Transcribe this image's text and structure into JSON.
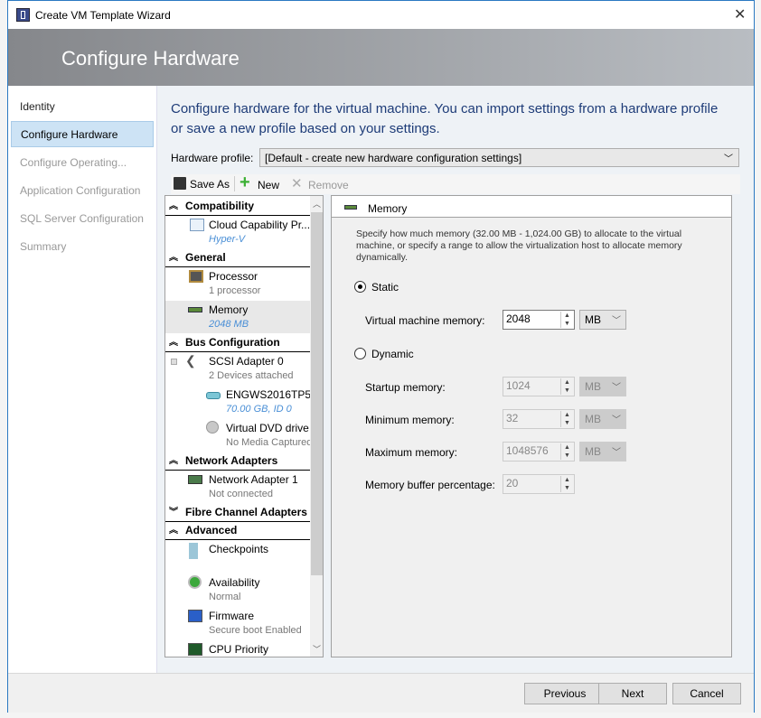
{
  "window": {
    "title": "Create VM Template Wizard"
  },
  "header": {
    "title": "Configure Hardware"
  },
  "nav": {
    "items": [
      {
        "label": "Identity",
        "state": "done"
      },
      {
        "label": "Configure Hardware",
        "state": "selected"
      },
      {
        "label": "Configure Operating...",
        "state": "pending"
      },
      {
        "label": "Application Configuration",
        "state": "pending"
      },
      {
        "label": "SQL Server Configuration",
        "state": "pending"
      },
      {
        "label": "Summary",
        "state": "pending"
      }
    ]
  },
  "main": {
    "intro": "Configure hardware for the virtual machine. You can import settings from a hardware profile or save a new profile based on your settings.",
    "profile_label": "Hardware profile:",
    "profile_value": "[Default - create new hardware configuration settings]",
    "toolbar": {
      "save_as": "Save As",
      "new": "New",
      "remove": "Remove"
    },
    "tree": {
      "groups": {
        "compatibility": "Compatibility",
        "general": "General",
        "bus": "Bus Configuration",
        "network": "Network Adapters",
        "fibre": "Fibre Channel Adapters",
        "advanced": "Advanced"
      },
      "items": {
        "cloud": {
          "title": "Cloud Capability Pr...",
          "sub": "Hyper-V"
        },
        "processor": {
          "title": "Processor",
          "sub": "1 processor"
        },
        "memory": {
          "title": "Memory",
          "sub": "2048 MB"
        },
        "scsi": {
          "title": "SCSI Adapter 0",
          "sub": "2 Devices attached"
        },
        "disk": {
          "title": "ENGWS2016TP5...",
          "sub": "70.00 GB, ID 0"
        },
        "dvd": {
          "title": "Virtual DVD drive",
          "sub": "No Media Captured"
        },
        "nic": {
          "title": "Network Adapter 1",
          "sub": "Not connected"
        },
        "checkpoints": {
          "title": "Checkpoints"
        },
        "availability": {
          "title": "Availability",
          "sub": "Normal"
        },
        "firmware": {
          "title": "Firmware",
          "sub": "Secure boot Enabled"
        },
        "cpu_priority": {
          "title": "CPU Priority"
        }
      }
    },
    "memory_panel": {
      "title": "Memory",
      "description": "Specify how much memory (32.00 MB - 1,024.00 GB) to allocate to the virtual machine, or specify a range to allow the virtualization host to allocate memory dynamically.",
      "static_label": "Static",
      "static_selected": true,
      "vm_memory_label": "Virtual machine memory:",
      "vm_memory_value": "2048",
      "vm_memory_unit": "MB",
      "dynamic_label": "Dynamic",
      "startup_label": "Startup memory:",
      "startup_value": "1024",
      "startup_unit": "MB",
      "min_label": "Minimum memory:",
      "min_value": "32",
      "min_unit": "MB",
      "max_label": "Maximum memory:",
      "max_value": "1048576",
      "max_unit": "MB",
      "buffer_label": "Memory buffer percentage:",
      "buffer_value": "20"
    }
  },
  "footer": {
    "previous": "Previous",
    "next": "Next",
    "cancel": "Cancel"
  }
}
